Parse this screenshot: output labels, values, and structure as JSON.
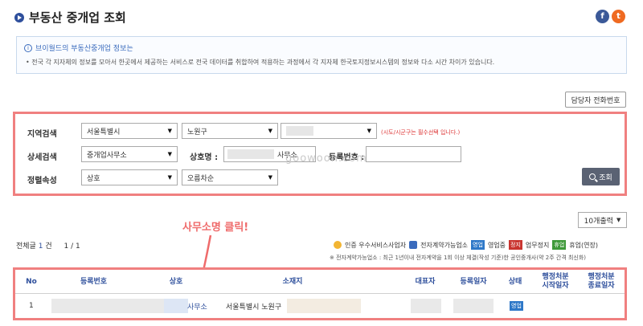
{
  "header": {
    "title": "부동산 중개업 조회"
  },
  "social": {
    "facebook_glyph": "f",
    "twitter_glyph": "t"
  },
  "info": {
    "title": "브이월드의 부동산중개업 정보는",
    "text": "• 전국 각 지자체의 정보를 모아서 한곳에서 제공하는 서비스로 전국 데이터를 취합하여 적용하는 과정에서 각 지자체 한국토지정보시스템의 정보와 다소 시간 차이가 있습니다."
  },
  "buttons": {
    "phone": "담당자 전화번호",
    "search": "조회",
    "per_page": "10개출력"
  },
  "search": {
    "region_label": "지역검색",
    "region_sido": "서울특별시",
    "region_sigungu": "노원구",
    "region_required_note": "(시도/시군구는 필수선택 입니다.)",
    "detail_label": "상세검색",
    "detail_type": "중개업사무소",
    "name_label": "상호명 :",
    "name_value": "사무소",
    "reg_label": "등록번호 :",
    "sort_label": "정렬속성",
    "sort_field": "상호",
    "sort_order": "오름차순"
  },
  "watermark": "goowoon.com",
  "annotation": "사무소명 클릭!",
  "results": {
    "total_prefix": "전체글",
    "total_count": "1",
    "total_suffix": "건",
    "page_info": "1 / 1"
  },
  "legend": {
    "certified": "인증 우수서비스사업자",
    "econtract": "전자계약가능업소",
    "open_badge": "영업",
    "open_label": "영업중",
    "suspended_badge": "정지",
    "suspended_label": "업무정지",
    "closed_badge": "휴업",
    "closed_label": "휴업(연장)",
    "note": "※ 전자계약가능업소 : 최근 1년이내 전자계약을 1회 이상 체결(작성 기준)한 공인중개사(약 2주 간격 최신화)"
  },
  "table": {
    "headers": {
      "no": "No",
      "reg_no": "등록번호",
      "name": "상호",
      "address": "소재지",
      "rep": "대표자",
      "reg_date": "등록일자",
      "status": "상태",
      "admin_start": "행정처분\n시작일자",
      "admin_end": "행정처분\n종료일자"
    },
    "row": {
      "no": "1",
      "name": "사무소",
      "address": "서울특별시 노원구",
      "status": "영업"
    }
  },
  "colors": {
    "accent": "#2e4f9c",
    "highlight_border": "#f08080",
    "annotation": "#ef6b6b"
  }
}
